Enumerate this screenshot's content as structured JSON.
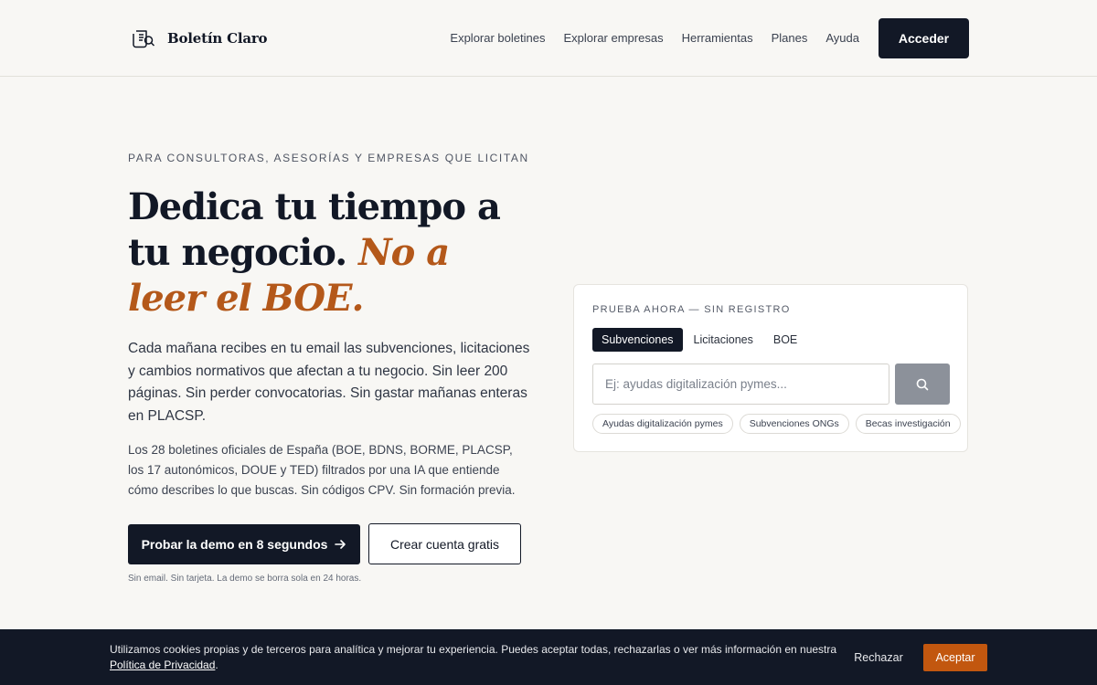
{
  "brand": {
    "name": "Boletín Claro",
    "logo_icon": "newspaper-icon"
  },
  "nav": {
    "items": [
      {
        "label": "Explorar boletines"
      },
      {
        "label": "Explorar empresas"
      },
      {
        "label": "Herramientas"
      },
      {
        "label": "Planes"
      },
      {
        "label": "Ayuda"
      }
    ],
    "login_label": "Acceder"
  },
  "hero": {
    "eyebrow": "PARA CONSULTORAS, ASESORÍAS Y EMPRESAS QUE LICITAN",
    "headline_main": "Dedica tu tiempo a tu negocio.",
    "headline_accent": "No a leer el BOE.",
    "lead": "Cada mañana recibes en tu email las subvenciones, licitaciones y cambios normativos que afectan a tu negocio. Sin leer 200 páginas. Sin perder convocatorias. Sin gastar mañanas enteras en PLACSP.",
    "sub": "Los 28 boletines oficiales de España (BOE, BDNS, BORME, PLACSP, los 17 autonómicos, DOUE y TED) filtrados por una IA que entiende cómo describes lo que buscas. Sin códigos CPV. Sin formación previa.",
    "cta_primary": "Probar la demo en 8 segundos",
    "cta_primary_icon": "arrow-right-icon",
    "cta_secondary": "Crear cuenta gratis",
    "fineprint": "Sin email. Sin tarjeta. La demo se borra sola en 24 horas."
  },
  "demo": {
    "eyebrow": "PRUEBA AHORA — SIN REGISTRO",
    "tabs": [
      {
        "label": "Subvenciones",
        "active": true
      },
      {
        "label": "Licitaciones",
        "active": false
      },
      {
        "label": "BOE",
        "active": false
      }
    ],
    "search_placeholder": "Ej: ayudas digitalización pymes...",
    "search_value": "",
    "search_icon": "search-icon",
    "suggestions": [
      "Ayudas digitalización pymes",
      "Subvenciones ONGs",
      "Becas investigación"
    ]
  },
  "cookie": {
    "text": "Utilizamos cookies propias y de terceros para analítica y mejorar tu experiencia. Puedes aceptar todas, rechazarlas o ver más información en nuestra",
    "link": "Política de Privacidad",
    "link_suffix": ".",
    "reject_label": "Rechazar",
    "accept_label": "Aceptar"
  },
  "colors": {
    "primary": "#121826",
    "accent": "#b4581a",
    "accept": "#c2570f",
    "background": "#f8f7f4"
  }
}
